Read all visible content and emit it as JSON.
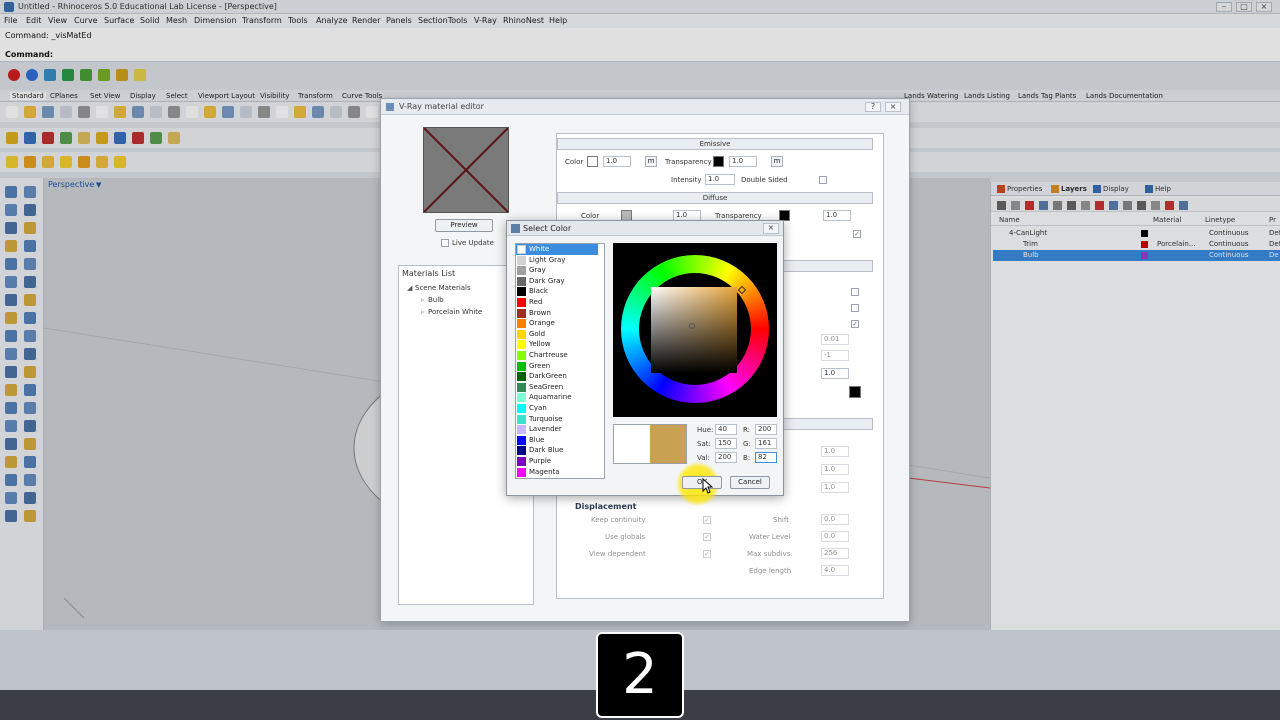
{
  "window": {
    "title": "Untitled - Rhinoceros 5.0 Educational Lab License - [Perspective]"
  },
  "menu": [
    "File",
    "Edit",
    "View",
    "Curve",
    "Surface",
    "Solid",
    "Mesh",
    "Dimension",
    "Transform",
    "Tools",
    "Analyze",
    "Render",
    "Panels",
    "SectionTools",
    "V-Ray",
    "RhinoNest",
    "Help"
  ],
  "command": {
    "history": "Command: _visMatEd",
    "prompt": "Command:"
  },
  "tabs": [
    "Standard",
    "CPlanes",
    "Set View",
    "Display",
    "Select",
    "Viewport Layout",
    "Visibility",
    "Transform",
    "Curve Tools",
    "Lands Watering",
    "Lands Listing",
    "Lands Tag Plants",
    "Lands Documentation"
  ],
  "viewport": {
    "title": "Perspective"
  },
  "right_panel": {
    "tabs": [
      "Properties",
      "Layers",
      "Display",
      "Help"
    ],
    "columns": [
      "Name",
      "Material",
      "Linetype",
      "Pr"
    ],
    "rows": [
      {
        "name": "4-CanLight",
        "material": "",
        "linetype": "Continuous",
        "print": "Def",
        "color": "#000000"
      },
      {
        "name": "Trim",
        "material": "Porcelain...",
        "linetype": "Continuous",
        "print": "Def",
        "color": "#cc0000"
      },
      {
        "name": "Bulb",
        "material": "",
        "linetype": "Continuous",
        "print": "De",
        "color": "#9a3fd0"
      }
    ]
  },
  "vray": {
    "title": "V-Ray material editor",
    "preview_button": "Preview",
    "live_update": "Live Update",
    "materials_list": "Materials List",
    "scene_materials": "Scene Materials",
    "materials": [
      "Bulb",
      "Porcelain White"
    ],
    "emissive": {
      "header": "Emissive",
      "color_label": "Color",
      "color_value": "1.0",
      "m": "m",
      "transparency_label": "Transparency",
      "transparency_value": "1.0",
      "intensity_label": "Intensity",
      "intensity_value": "1.0",
      "double_sided": "Double Sided"
    },
    "diffuse": {
      "header": "Diffuse",
      "color_label": "Color",
      "color_value": "1.0",
      "transparency_label": "Transparency",
      "transparency_value": "1.0"
    },
    "side_values": [
      "0.01",
      "-1",
      "1.0"
    ],
    "map_values": [
      "1.0",
      "1.0",
      "1.0"
    ],
    "displacement": {
      "header": "Displacement",
      "keep_continuity": "Keep continuity",
      "use_globals": "Use globals",
      "view_dependent": "View dependent",
      "shift_label": "Shift",
      "shift_value": "0.0",
      "water_label": "Water Level",
      "water_value": "0.0",
      "subdivs_label": "Max subdivs",
      "subdivs_value": "256",
      "edge_label": "Edge length",
      "edge_value": "4.0"
    }
  },
  "select_color": {
    "title": "Select Color",
    "colors": [
      {
        "name": "White",
        "hex": "#ffffff"
      },
      {
        "name": "Light Gray",
        "hex": "#d3d3d3"
      },
      {
        "name": "Gray",
        "hex": "#a0a0a0"
      },
      {
        "name": "Dark Gray",
        "hex": "#696969"
      },
      {
        "name": "Black",
        "hex": "#000000"
      },
      {
        "name": "Red",
        "hex": "#ff0000"
      },
      {
        "name": "Brown",
        "hex": "#a52a2a"
      },
      {
        "name": "Orange",
        "hex": "#ff8000"
      },
      {
        "name": "Gold",
        "hex": "#ffd700"
      },
      {
        "name": "Yellow",
        "hex": "#ffff00"
      },
      {
        "name": "Chartreuse",
        "hex": "#7fff00"
      },
      {
        "name": "Green",
        "hex": "#00c000"
      },
      {
        "name": "DarkGreen",
        "hex": "#006400"
      },
      {
        "name": "SeaGreen",
        "hex": "#2e8b57"
      },
      {
        "name": "Aquamarine",
        "hex": "#7fffd4"
      },
      {
        "name": "Cyan",
        "hex": "#00ffff"
      },
      {
        "name": "Turquoise",
        "hex": "#40e0d0"
      },
      {
        "name": "Lavender",
        "hex": "#c8b8ff"
      },
      {
        "name": "Blue",
        "hex": "#0000ff"
      },
      {
        "name": "Dark Blue",
        "hex": "#00008b"
      },
      {
        "name": "Purple",
        "hex": "#8000c0"
      },
      {
        "name": "Magenta",
        "hex": "#ff00ff"
      }
    ],
    "selected_index": 0,
    "hue_label": "Hue:",
    "hue": "40",
    "sat_label": "Sat:",
    "sat": "150",
    "val_label": "Val:",
    "val": "200",
    "r_label": "R:",
    "r": "200",
    "g_label": "G:",
    "g": "161",
    "b_label": "B:",
    "b": "82",
    "new_color": "#c8a152",
    "old_color": "#ffffff",
    "ok": "OK",
    "cancel": "Cancel"
  },
  "step_badge": "2"
}
